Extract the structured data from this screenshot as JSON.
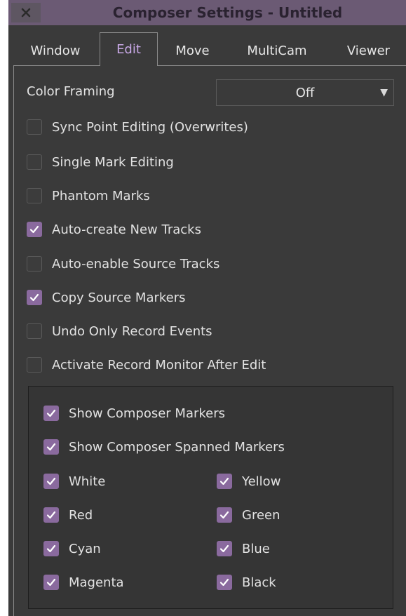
{
  "window": {
    "title": "Composer Settings - Untitled",
    "close_icon": "close-x-icon"
  },
  "tabs": [
    {
      "label": "Window",
      "active": false
    },
    {
      "label": "Edit",
      "active": true
    },
    {
      "label": "Move",
      "active": false
    },
    {
      "label": "MultiCam",
      "active": false
    },
    {
      "label": "Viewer",
      "active": false
    }
  ],
  "color_framing": {
    "label": "Color Framing",
    "value": "Off",
    "arrow_icon": "dropdown-triangle-icon"
  },
  "options": [
    {
      "label": "Sync Point Editing (Overwrites)",
      "checked": false
    },
    {
      "label": "Single Mark Editing",
      "checked": false
    },
    {
      "label": "Phantom Marks",
      "checked": false
    },
    {
      "label": "Auto-create New Tracks",
      "checked": true
    },
    {
      "label": "Auto-enable Source Tracks",
      "checked": false
    },
    {
      "label": "Copy Source Markers",
      "checked": true
    },
    {
      "label": "Undo Only Record Events",
      "checked": false
    },
    {
      "label": "Activate Record Monitor After Edit",
      "checked": false
    }
  ],
  "markers": {
    "show_composer_markers": {
      "label": "Show Composer Markers",
      "checked": true
    },
    "show_spanned_markers": {
      "label": "Show Composer Spanned Markers",
      "checked": true
    },
    "colors": [
      {
        "label": "White",
        "checked": true
      },
      {
        "label": "Yellow",
        "checked": true
      },
      {
        "label": "Red",
        "checked": true
      },
      {
        "label": "Green",
        "checked": true
      },
      {
        "label": "Cyan",
        "checked": true
      },
      {
        "label": "Blue",
        "checked": true
      },
      {
        "label": "Magenta",
        "checked": true
      },
      {
        "label": "Black",
        "checked": true
      }
    ]
  },
  "colors": {
    "titlebar": "#6b5a74",
    "accent": "#8a6a9e",
    "active_tab_text": "#c8a8e6",
    "background": "#3a3a3a"
  }
}
